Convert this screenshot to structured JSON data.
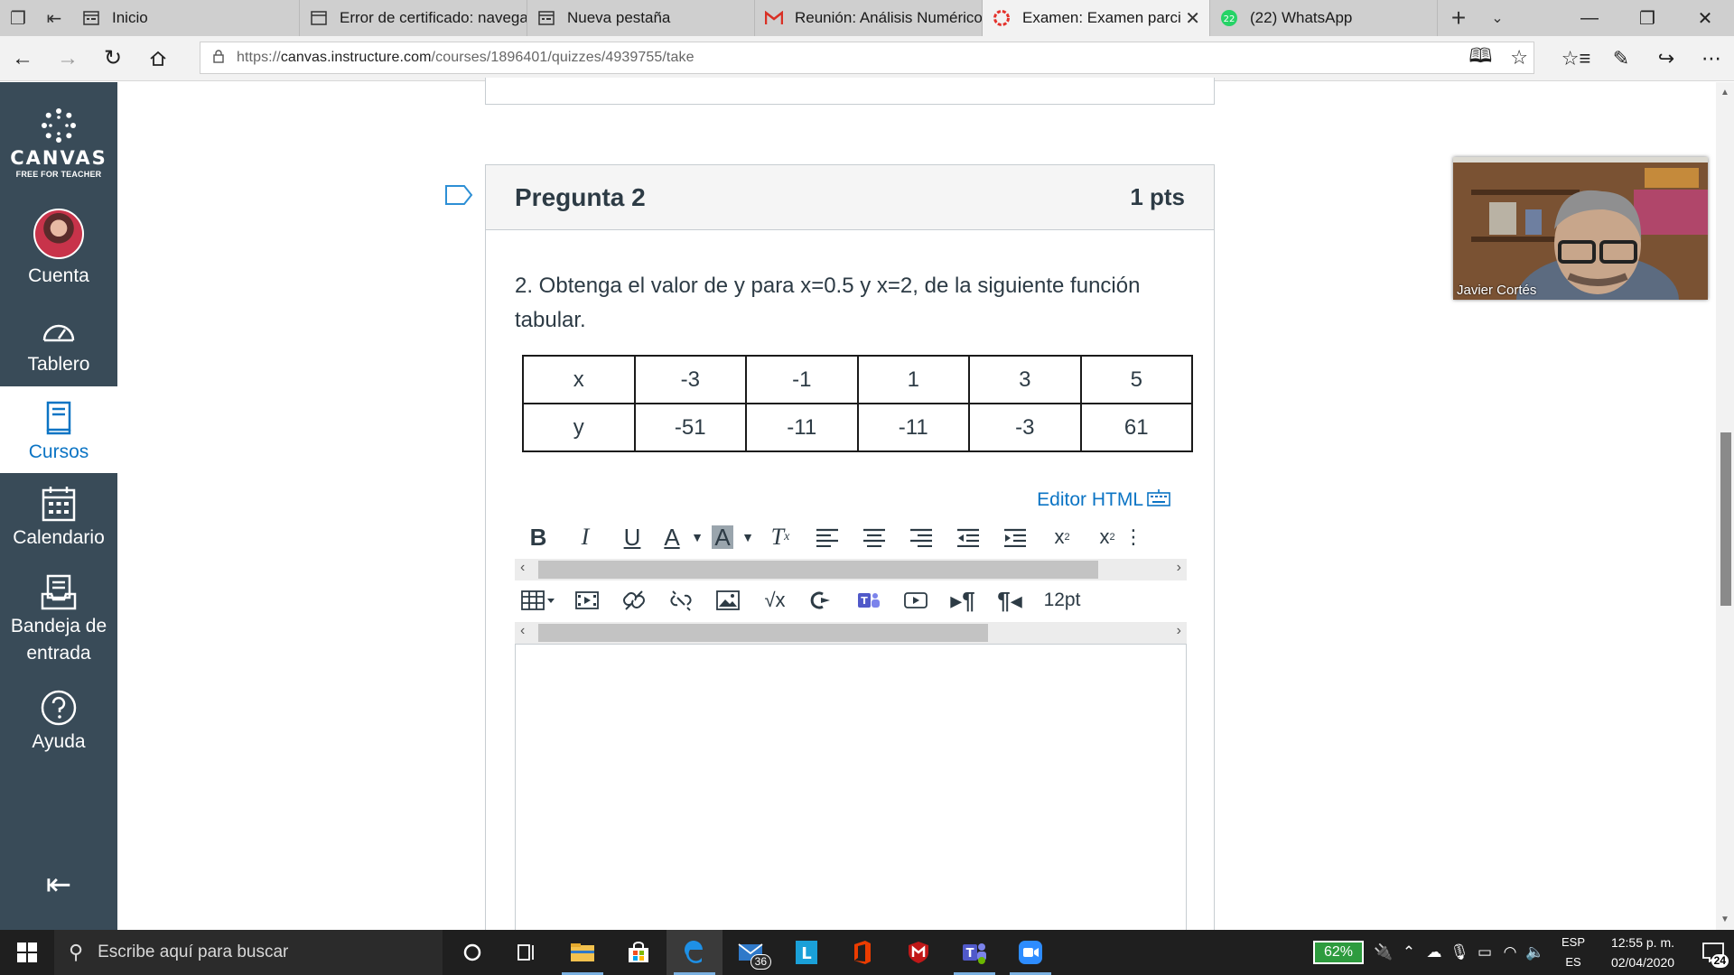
{
  "browser": {
    "tabs": [
      {
        "title": "Inicio",
        "icon": "page-icon"
      },
      {
        "title": "Error de certificado: navega",
        "icon": "page-icon"
      },
      {
        "title": "Nueva pestaña",
        "icon": "page-icon"
      },
      {
        "title": "Reunión: Análisis Numérico",
        "icon": "gmail-icon"
      },
      {
        "title": "Examen: Examen parcial",
        "icon": "canvas-icon",
        "active": true
      },
      {
        "title": "(22) WhatsApp",
        "icon": "whatsapp-icon"
      }
    ],
    "url": {
      "scheme": "https://",
      "domain": "canvas.instructure.com",
      "path": "/courses/1896401/quizzes/4939755/take"
    }
  },
  "canvas_nav": {
    "logo_word": "CANVAS",
    "logo_sub": "FREE FOR TEACHER",
    "items": [
      {
        "label": "Cuenta",
        "icon": "avatar"
      },
      {
        "label": "Tablero",
        "icon": "dashboard-icon"
      },
      {
        "label": "Cursos",
        "icon": "courses-icon",
        "active": true
      },
      {
        "label": "Calendario",
        "icon": "calendar-icon"
      },
      {
        "label": "Bandeja de entrada",
        "icon": "inbox-icon"
      },
      {
        "label": "Ayuda",
        "icon": "help-icon"
      }
    ]
  },
  "question": {
    "title": "Pregunta 2",
    "points": "1 pts",
    "text": "2. Obtenga el valor de y para x=0.5 y x=2, de la siguiente función tabular.",
    "table": [
      [
        "x",
        "-3",
        "-1",
        "1",
        "3",
        "5"
      ],
      [
        "y",
        "-51",
        "-11",
        "-11",
        "-3",
        "61"
      ]
    ],
    "html_editor_label": "Editor HTML",
    "font_size": "12pt"
  },
  "video": {
    "participant": "Javier Cortés"
  },
  "taskbar": {
    "search_placeholder": "Escribe aquí para buscar",
    "mail_badge": "36",
    "battery": "62%",
    "lang_top": "ESP",
    "lang_bottom": "ES",
    "time": "12:55 p. m.",
    "date": "02/04/2020",
    "notifications": "24"
  },
  "colors": {
    "canvas_nav_bg": "#394b58",
    "canvas_blue": "#0b74c4",
    "text": "#2d3b45"
  }
}
